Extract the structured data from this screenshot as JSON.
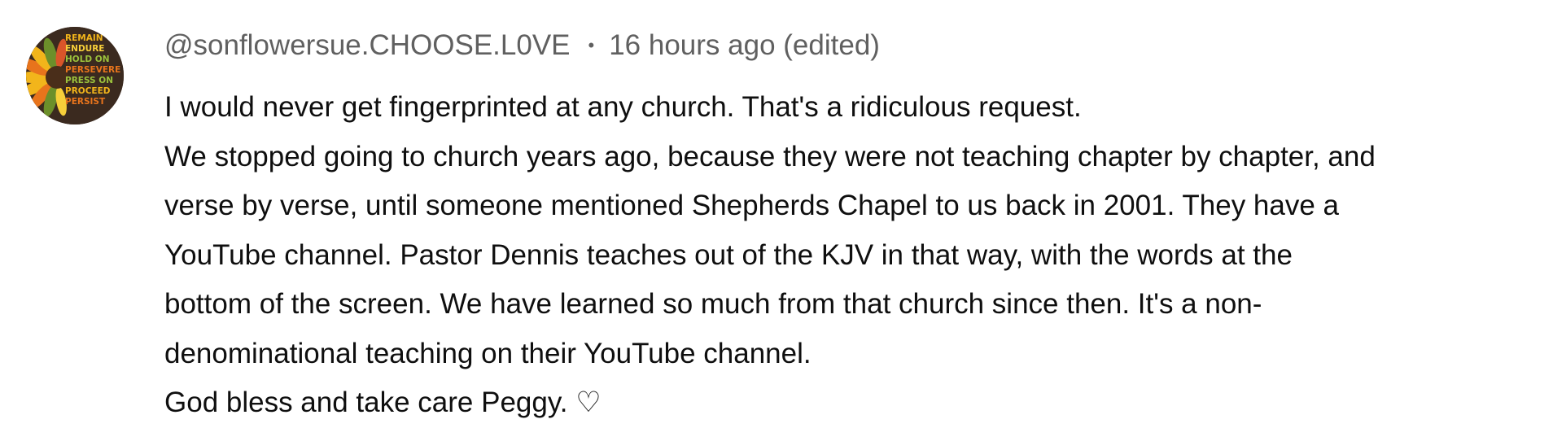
{
  "comment": {
    "avatar": {
      "icon": "sunflower-avatar-icon",
      "words": [
        "REMAIN",
        "ENDURE",
        "HOLD ON",
        "PERSEVERE",
        "PRESS ON",
        "PROCEED",
        "PERSIST"
      ],
      "colors": {
        "background": "#3b2a1f",
        "petal_yellow": "#f2b51b",
        "petal_orange": "#e8741c",
        "leaf_green": "#6c8f2a",
        "center_brown": "#4a2e1a"
      }
    },
    "author": "@sonflowersue.CHOOSE.L0VE",
    "separator": "•",
    "timestamp": "16 hours ago (edited)",
    "text_lines": [
      "I would never get fingerprinted at any church. That's a ridiculous request.",
      "We stopped going to church years ago, because they were not teaching chapter by chapter, and",
      "verse by verse, until someone mentioned Shepherds Chapel to us back in 2001. They have a",
      "YouTube channel. Pastor Dennis teaches out of the KJV in that way, with the words at the",
      "bottom of the screen. We have learned so much from that church since then. It's a non-",
      "denominational teaching on their YouTube channel.",
      "God bless and take care Peggy. ♡"
    ],
    "colors": {
      "text": "#0f0f0f",
      "meta": "#606060"
    }
  }
}
